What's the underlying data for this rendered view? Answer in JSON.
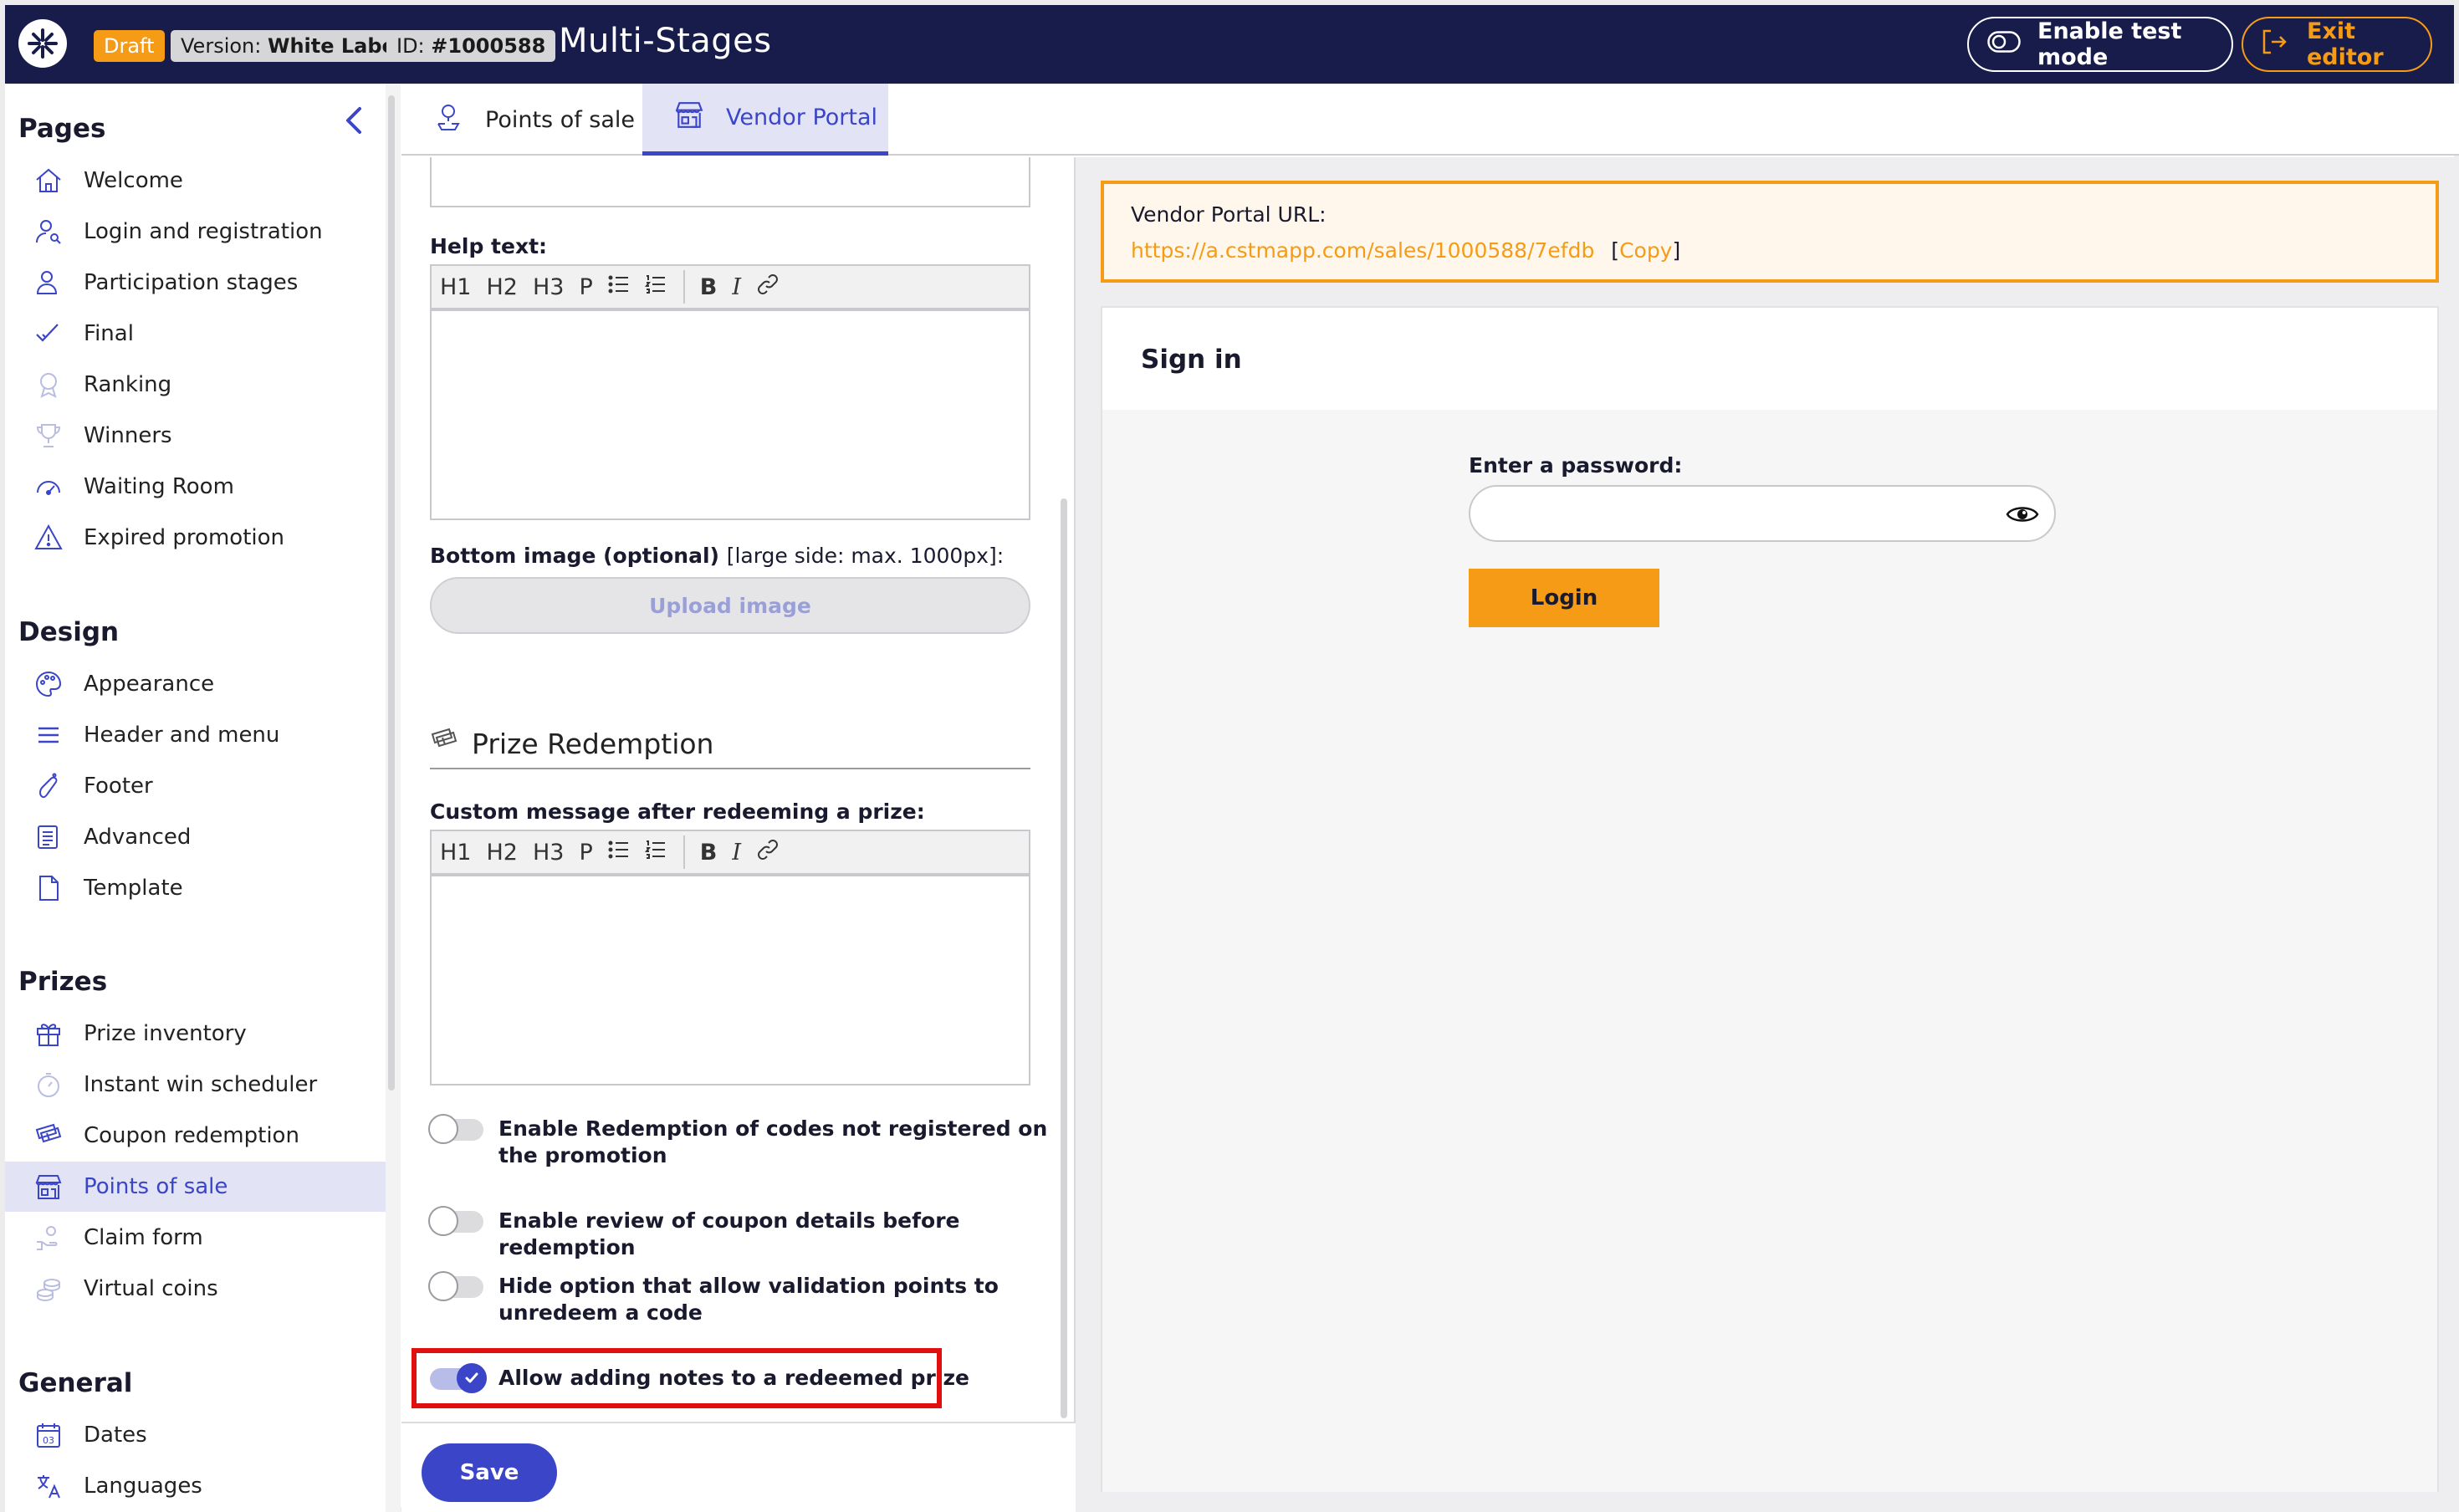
{
  "topbar": {
    "draft": "Draft",
    "version_prefix": "Version:",
    "version_value": "White Label",
    "id_prefix": "ID:",
    "id_value": "#1000588",
    "title": "Multi-Stages",
    "test_mode": "Enable test mode",
    "exit": "Exit editor"
  },
  "sidebar": {
    "sections": {
      "pages": "Pages",
      "design": "Design",
      "prizes": "Prizes",
      "general": "General"
    },
    "pages": [
      "Welcome",
      "Login and registration",
      "Participation stages",
      "Final",
      "Ranking",
      "Winners",
      "Waiting Room",
      "Expired promotion"
    ],
    "design": [
      "Appearance",
      "Header and menu",
      "Footer",
      "Advanced",
      "Template"
    ],
    "prizes": [
      "Prize inventory",
      "Instant win scheduler",
      "Coupon redemption",
      "Points of sale",
      "Claim form",
      "Virtual coins"
    ],
    "general": [
      "Dates",
      "Languages"
    ],
    "active_item": "Points of sale"
  },
  "tabs": [
    "Points of sale",
    "Vendor Portal"
  ],
  "form": {
    "help_text_label": "Help text:",
    "toolbar": [
      "H1",
      "H2",
      "H3",
      "P",
      "B",
      "I"
    ],
    "bottom_image_label": "Bottom image (optional)",
    "bottom_image_hint": "[large side: max. 1000px]:",
    "upload_image": "Upload image",
    "prize_redemption": "Prize Redemption",
    "custom_message_label": "Custom message after redeeming a prize:",
    "toggles": [
      {
        "label": "Enable Redemption of codes not registered on the promotion",
        "on": false
      },
      {
        "label": "Enable review of coupon details before redemption",
        "on": false
      },
      {
        "label": "Hide option that allow validation points to unredeem a code",
        "on": false
      },
      {
        "label": "Allow adding notes to a redeemed prize",
        "on": true
      }
    ],
    "save": "Save"
  },
  "preview": {
    "url_label": "Vendor Portal URL:",
    "url": "https://a.cstmapp.com/sales/1000588/7efdb",
    "copy": "Copy",
    "signin_title": "Sign in",
    "password_label": "Enter a password:",
    "login": "Login"
  },
  "colors": {
    "topbar": "#181c4a",
    "accent": "#3a45c8",
    "orange": "#f59b16",
    "highlight": "#e01010"
  }
}
